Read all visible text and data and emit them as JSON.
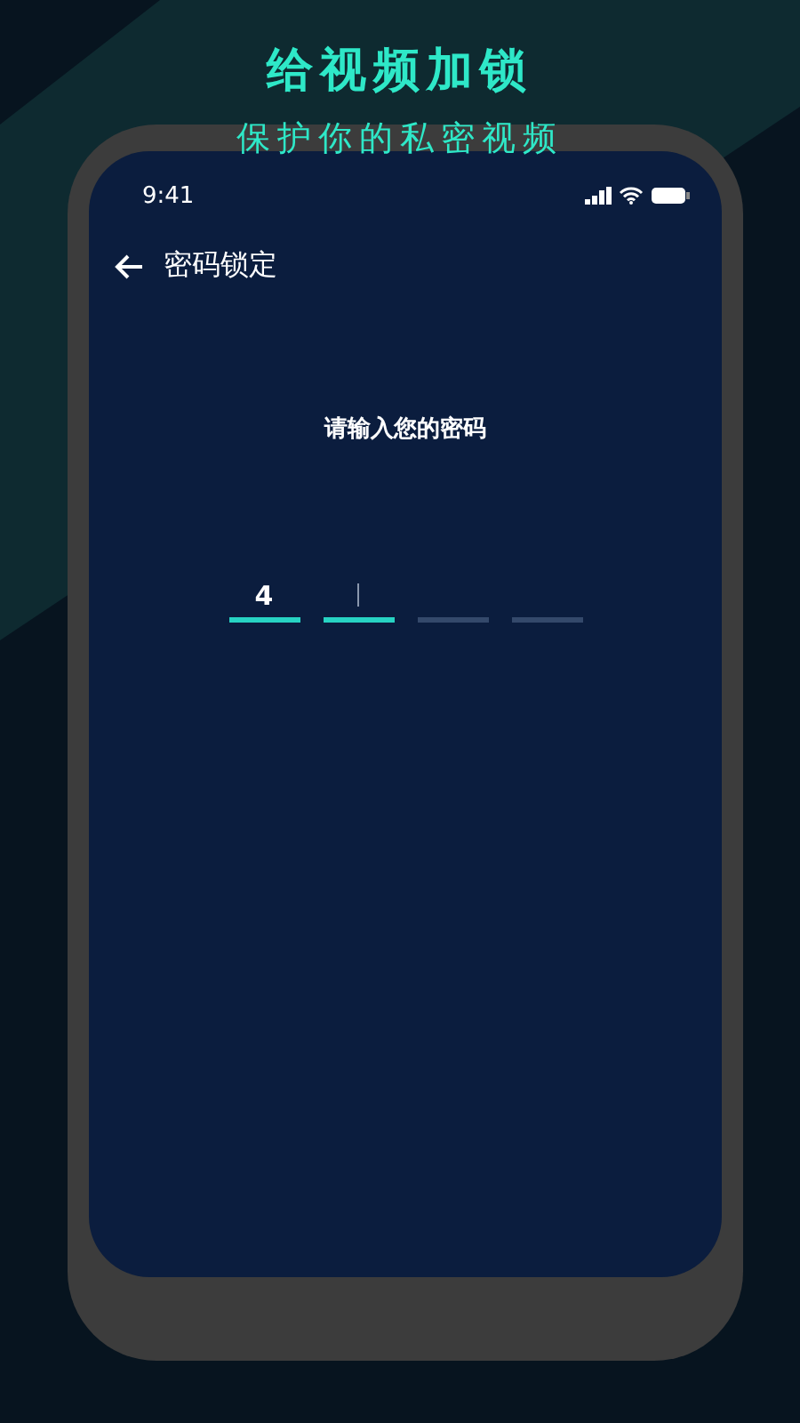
{
  "headline": "给视频加锁",
  "subheadline": "保护你的私密视频",
  "status_bar": {
    "time": "9:41"
  },
  "nav": {
    "title": "密码锁定"
  },
  "prompt": "请输入您的密码",
  "pin_slots": [
    {
      "value": "4",
      "focused": false
    },
    {
      "focused": true
    },
    {
      "focused": false
    },
    {
      "focused": false
    }
  ]
}
